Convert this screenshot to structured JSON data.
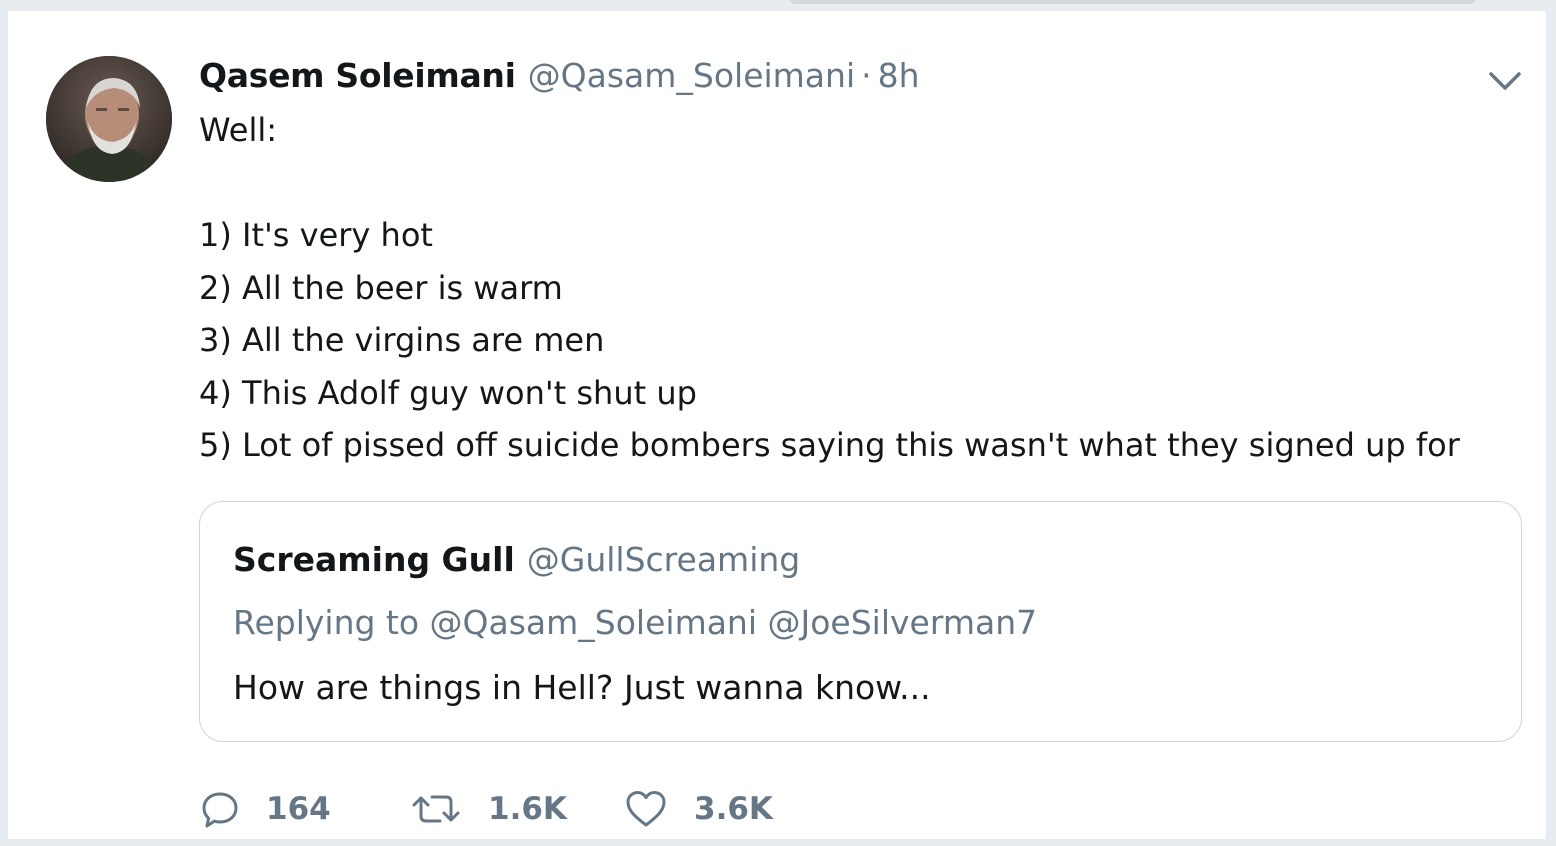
{
  "tweet": {
    "author": {
      "display_name": "Qasem Soleimani",
      "handle": "@Qasam_Soleimani",
      "avatar_icon": "profile-photo"
    },
    "separator": "·",
    "time": "8h",
    "text_lines": [
      "Well:",
      "",
      "1) It's very hot",
      "2) All the beer is warm",
      "3) All the virgins are men",
      "4) This Adolf guy won't shut up",
      "5) Lot of pissed off suicide bombers saying this wasn't what they signed up for"
    ],
    "quoted": {
      "display_name": "Screaming Gull",
      "handle": "@GullScreaming",
      "replying_to": "Replying to @Qasam_Soleimani @JoeSilverman7",
      "text": "How are things in Hell? Just wanna know..."
    },
    "actions": {
      "reply": {
        "icon": "reply-icon",
        "count": "164"
      },
      "retweet": {
        "icon": "retweet-icon",
        "count": "1.6K"
      },
      "like": {
        "icon": "heart-icon",
        "count": "3.6K"
      }
    },
    "colors": {
      "text": "#14171a",
      "secondary": "#657786",
      "border": "#ccd6dd",
      "background": "#e6ecf0"
    }
  }
}
